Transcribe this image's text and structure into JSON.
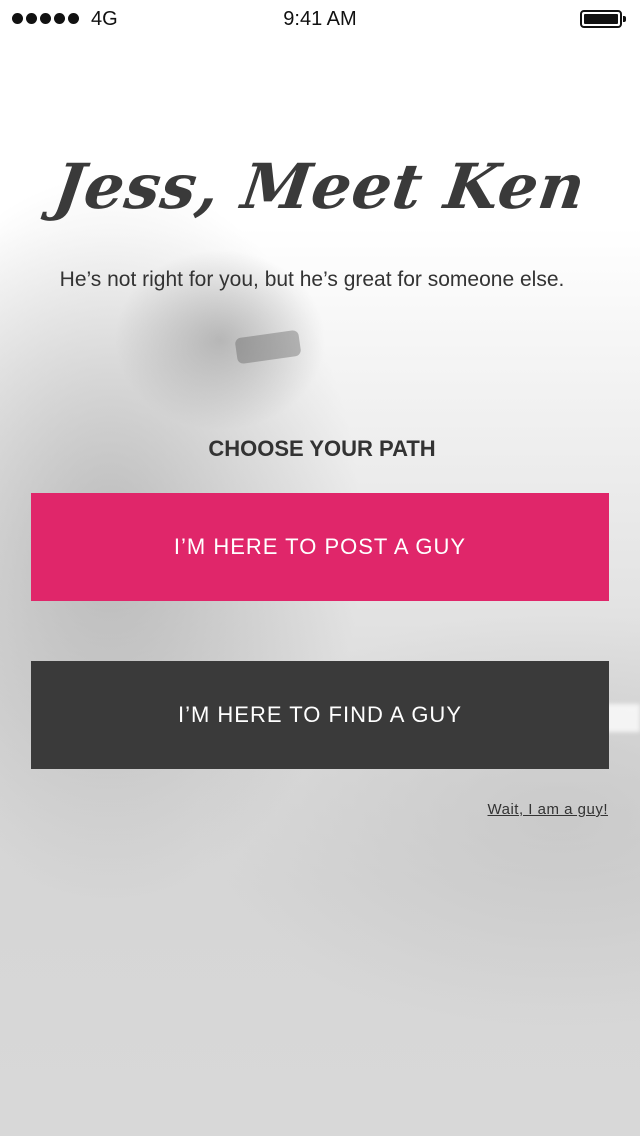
{
  "status_bar": {
    "carrier": "4G",
    "time": "9:41 AM",
    "signal_icon": "signal-dots-icon",
    "battery_icon": "battery-icon"
  },
  "main": {
    "headline": "Jess, Meet Ken",
    "subtitle": "He’s not right for you, but he’s great for someone else.",
    "section_label": "CHOOSE YOUR PATH",
    "post_button_label": "I’M HERE TO POST A GUY",
    "find_button_label": "I’M HERE TO FIND A GUY",
    "guy_link_label": "Wait, I am a guy!"
  },
  "colors": {
    "post_button": "#e0266a",
    "find_button": "#3a3a3a",
    "text_dark": "#333333"
  }
}
